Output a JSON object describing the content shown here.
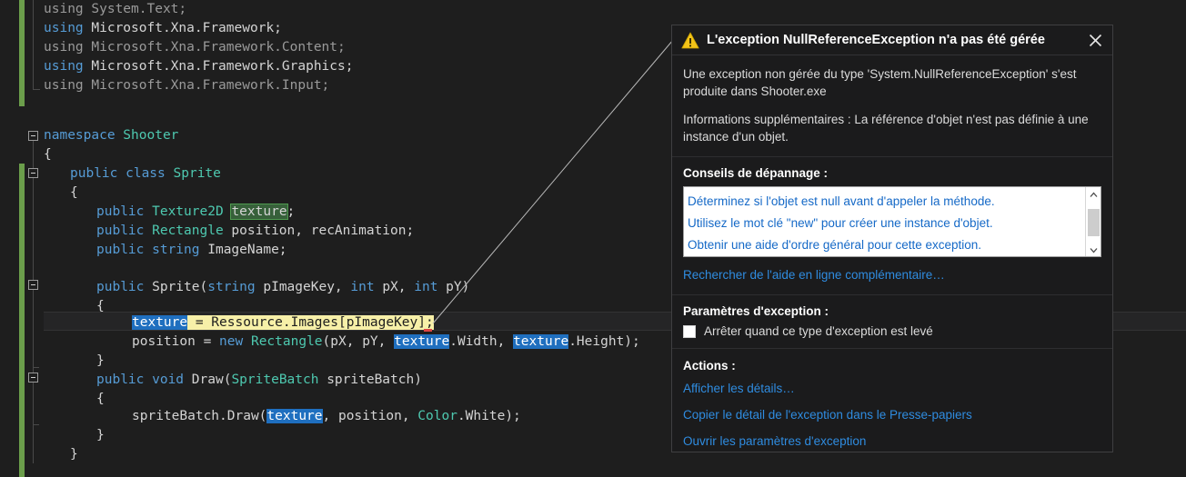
{
  "editor": {
    "language": "csharp",
    "gutter_change_color": "#6b9e4b",
    "lines": [
      {
        "indent": 0,
        "segments": [
          {
            "t": "using ",
            "c": "kw-dim"
          },
          {
            "t": "System",
            "c": "dim"
          },
          {
            "t": ".Text;",
            "c": "dim"
          }
        ]
      },
      {
        "indent": 0,
        "segments": [
          {
            "t": "using ",
            "c": "kw"
          },
          {
            "t": "Microsoft",
            "c": "pln"
          },
          {
            "t": ".Xna.Framework;",
            "c": "pln"
          }
        ]
      }
    ],
    "code_text": {
      "l1_using": "using",
      "l1_rest": " System.Text;",
      "l2_using": "using",
      "l2_rest": " Microsoft.Xna.Framework;",
      "l3_using": "using",
      "l3_rest": " Microsoft.Xna.Framework.Content;",
      "l4_using": "using",
      "l4_rest": " Microsoft.Xna.Framework.Graphics;",
      "l5_using": "using",
      "l5_rest": " Microsoft.Xna.Framework.Input;",
      "namespace_kw": "namespace",
      "namespace_name": " Shooter",
      "brace_open_ns": "{",
      "public1": "public",
      "class_kw": " class",
      "class_name": " Sprite",
      "brace_open_class": "{",
      "f1_public": "public",
      "f1_type": " Texture2D",
      "f1_name": "texture",
      "f1_semi": ";",
      "f2_public": "public",
      "f2_type": " Rectangle",
      "f2_rest": " position, recAnimation;",
      "f3_public": "public",
      "f3_type": " string",
      "f3_rest": " ImageName;",
      "ctor_public": "public",
      "ctor_name": " Sprite(",
      "ctor_p1kw": "string",
      "ctor_p1": " pImageKey, ",
      "ctor_p2kw": "int",
      "ctor_p2": " pX, ",
      "ctor_p3kw": "int",
      "ctor_p3": " pY)",
      "brace_open_ctor": "{",
      "assign_sel": "texture",
      "assign_rest": " = Ressource.Images[pImageKey];",
      "pos_start": "position = ",
      "pos_new": "new",
      "pos_type": " Rectangle",
      "pos_args1": "(pX, pY, ",
      "pos_tex1": "texture",
      "pos_w": ".Width, ",
      "pos_tex2": "texture",
      "pos_h": ".Height);",
      "brace_close_ctor": "}",
      "draw_public": "public",
      "draw_void": " void",
      "draw_name": " Draw(",
      "draw_type": "SpriteBatch",
      "draw_param": " spriteBatch)",
      "brace_open_draw": "{",
      "draw_call_start": "spriteBatch.Draw(",
      "draw_call_tex": "texture",
      "draw_call_mid": ", position, ",
      "draw_call_color": "Color",
      "draw_call_end": ".White);",
      "brace_close_draw": "}",
      "brace_close_class": "}"
    }
  },
  "dialog": {
    "title": "L'exception NullReferenceException n'a pas été gérée",
    "warning_icon": "warning-triangle-icon",
    "close_icon": "close-icon",
    "message": "Une exception non gérée du type 'System.NullReferenceException' s'est produite dans Shooter.exe",
    "additional_info": "Informations supplémentaires : La référence d'objet n'est pas définie à une instance d'un objet.",
    "tips_heading": "Conseils de dépannage :",
    "tips": [
      "Déterminez si l'objet est null avant d'appeler la méthode.",
      "Utilisez le mot clé \"new\" pour créer une instance d'objet.",
      "Obtenir une aide d'ordre général pour cette exception."
    ],
    "search_online_link": "Rechercher de l'aide en ligne complémentaire…",
    "settings_heading": "Paramètres d'exception :",
    "break_checkbox_label": "Arrêter quand ce type d'exception est levé",
    "break_checkbox_checked": false,
    "actions_heading": "Actions :",
    "actions": [
      "Afficher les détails…",
      "Copier le détail de l'exception dans le Presse-papiers",
      "Ouvrir les paramètres d'exception"
    ],
    "scrollbar": {
      "up_icon": "chevron-up-icon",
      "down_icon": "chevron-down-icon"
    },
    "colors": {
      "background": "#1b1b1c",
      "border": "#3f3f41",
      "link": "#2f8ce0",
      "warning": "#f3c318"
    }
  }
}
